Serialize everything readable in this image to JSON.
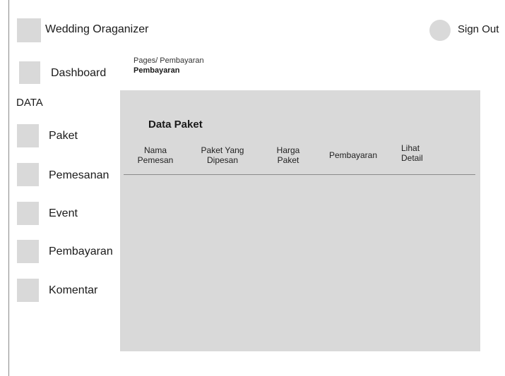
{
  "header": {
    "app_title": "Wedding Oraganizer",
    "sign_out": "Sign Out"
  },
  "sidebar": {
    "dashboard": "Dashboard",
    "section_label": "DATA",
    "items": [
      {
        "label": "Paket"
      },
      {
        "label": "Pemesanan"
      },
      {
        "label": "Event"
      },
      {
        "label": "Pembayaran"
      },
      {
        "label": "Komentar"
      }
    ]
  },
  "breadcrumb": {
    "path": "Pages/ Pembayaran",
    "current": "Pembayaran"
  },
  "panel": {
    "title": "Data Paket",
    "columns": [
      {
        "line1": "Nama",
        "line2": "Pemesan"
      },
      {
        "line1": "Paket Yang",
        "line2": "Dipesan"
      },
      {
        "line1": "Harga",
        "line2": "Paket"
      },
      {
        "line1": "Pembayaran",
        "line2": ""
      },
      {
        "line1": "Lihat",
        "line2": "Detail"
      }
    ],
    "rows": []
  },
  "colors": {
    "placeholder_gray": "#d9d9d9",
    "rule_gray": "#8a8a8a",
    "text": "#1a1a1a"
  }
}
